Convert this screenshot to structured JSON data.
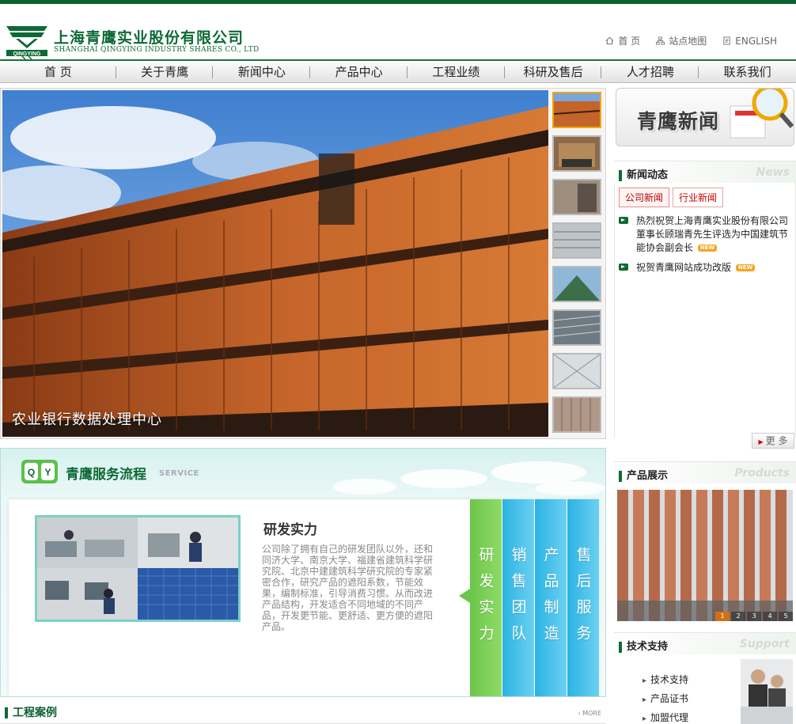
{
  "header": {
    "company_cn": "上海青鹰实业股份有限公司",
    "company_en": "SHANGHAI QINGYING INDUSTRY SHARES CO., LTD",
    "logo_text": "QINGYING",
    "links": [
      {
        "label": "首 页",
        "icon": "home-icon"
      },
      {
        "label": "站点地图",
        "icon": "sitemap-icon"
      },
      {
        "label": "ENGLISH",
        "icon": "document-icon"
      }
    ]
  },
  "nav": {
    "items": [
      "首 页",
      "关于青鹰",
      "新闻中心",
      "产品中心",
      "工程业绩",
      "科研及售后",
      "人才招聘",
      "联系我们"
    ]
  },
  "banner": {
    "caption": "农业银行数据处理中心",
    "thumb_count": 8,
    "active_thumb": 1
  },
  "service": {
    "title": "青鹰服务流程",
    "title_en": "SERVICE",
    "logo_letters": [
      "Q",
      "Y"
    ],
    "heading": "研发实力",
    "description": "公司除了拥有自己的研发团队以外，还和同济大学、南京大学、福建省建筑科学研究院、北京中建建筑科学研究院的专家紧密合作，研究产品的遮阳系数，节能效果，编制标准，引导消费习惯。从而改进产品结构，开发适合不同地域的不同产品，开发更节能、更舒适、更方便的遮阳产品。",
    "tabs": [
      "研发实力",
      "销售团队",
      "产品制造",
      "售后服务"
    ]
  },
  "cases": {
    "title": "工程案例",
    "more": "MORE"
  },
  "sidebar": {
    "news_banner": "青鹰新闻",
    "news_section": {
      "title": "新闻动态",
      "en": "News"
    },
    "news_tabs": [
      "公司新闻",
      "行业新闻"
    ],
    "news_items": [
      {
        "text": "热烈祝贺上海青鹰实业股份有限公司董事长顾瑞青先生评选为中国建筑节能协会副会长",
        "badge": "NEW"
      },
      {
        "text": "祝贺青鹰网站成功改版",
        "badge": "NEW"
      }
    ],
    "more": "更 多",
    "products_section": {
      "title": "产品展示",
      "en": "Products"
    },
    "product_pager": [
      "1",
      "2",
      "3",
      "4",
      "5"
    ],
    "product_active_page": 1,
    "support_section": {
      "title": "技术支持",
      "en": "Support"
    },
    "support_items": [
      "技术支持",
      "产品证书",
      "加盟代理"
    ]
  },
  "colors": {
    "brand_green": "#0d6a35",
    "accent_green": "#6bc64a",
    "accent_blue": "#2ab3e3",
    "news_tab_red": "#c00000"
  }
}
